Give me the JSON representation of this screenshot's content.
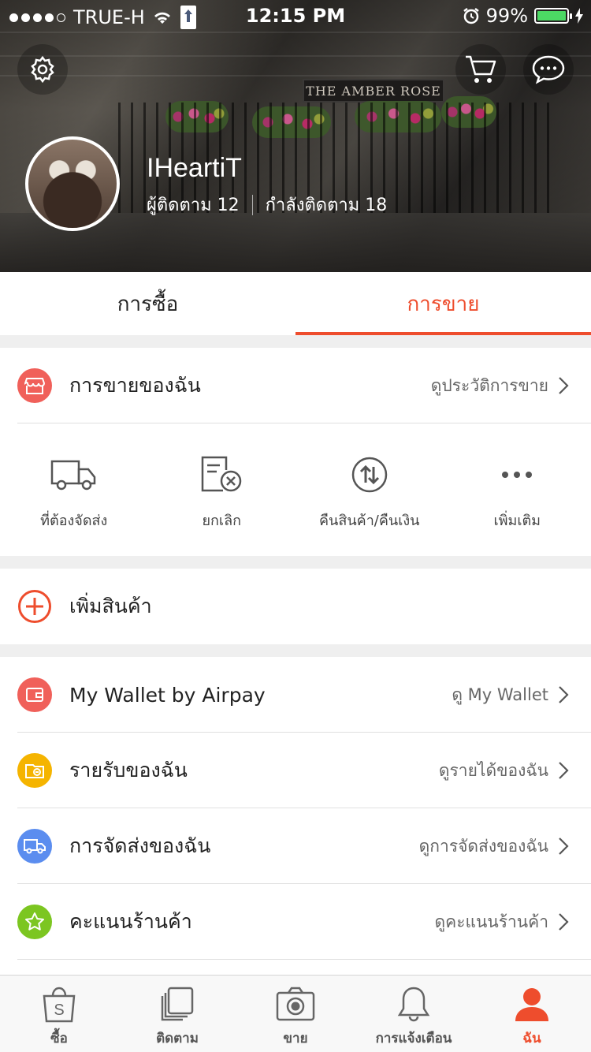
{
  "status_bar": {
    "carrier": "TRUE-H",
    "time": "12:15 PM",
    "battery": "99%",
    "battery_level": 0.99
  },
  "profile": {
    "username": "IHeartiT",
    "followers_label": "ผู้ติดตาม 12",
    "following_label": "กำลังติดตาม 18",
    "banner_sign": "THE AMBER ROSE"
  },
  "tabs": [
    {
      "label": "การซื้อ"
    },
    {
      "label": "การขาย"
    }
  ],
  "my_sales": {
    "title": "การขายของฉัน",
    "link": "ดูประวัติการขาย",
    "actions": [
      {
        "label": "ที่ต้องจัดส่ง",
        "icon": "truck-icon"
      },
      {
        "label": "ยกเลิก",
        "icon": "cancel-document-icon"
      },
      {
        "label": "คืนสินค้า/คืนเงิน",
        "icon": "return-refund-icon"
      },
      {
        "label": "เพิ่มเติม",
        "icon": "more-dots-icon"
      }
    ]
  },
  "add_product": {
    "label": "เพิ่มสินค้า"
  },
  "menu": [
    {
      "title": "My Wallet by Airpay",
      "link": "ดู My Wallet",
      "icon": "wallet-icon",
      "color": "#f0605a"
    },
    {
      "title": "รายรับของฉัน",
      "link": "ดูรายได้ของฉัน",
      "icon": "income-icon",
      "color": "#f5b400"
    },
    {
      "title": "การจัดส่งของฉัน",
      "link": "ดูการจัดส่งของฉัน",
      "icon": "shipping-icon",
      "color": "#5b8def"
    },
    {
      "title": "คะแนนร้านค้า",
      "link": "ดูคะแนนร้านค้า",
      "icon": "star-icon",
      "color": "#7cc621"
    }
  ],
  "bottom_nav": [
    {
      "label": "ซื้อ",
      "icon": "shopping-bag-icon"
    },
    {
      "label": "ติดตาม",
      "icon": "feed-icon"
    },
    {
      "label": "ขาย",
      "icon": "camera-icon"
    },
    {
      "label": "การแจ้งเตือน",
      "icon": "bell-icon"
    },
    {
      "label": "ฉัน",
      "icon": "profile-icon"
    }
  ],
  "colors": {
    "accent": "#ee4d2d",
    "sales_icon": "#f0605a"
  }
}
